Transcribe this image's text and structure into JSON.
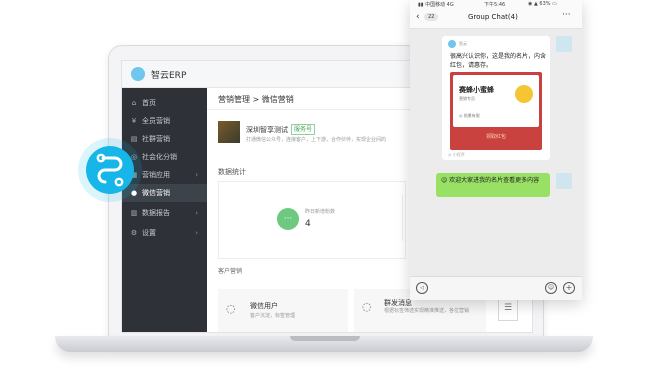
{
  "app": {
    "title": "智云ERP"
  },
  "sidebar": {
    "items": [
      {
        "icon": "home-icon",
        "glyph": "⌂",
        "label": "首页",
        "chevron": false
      },
      {
        "icon": "coins-icon",
        "glyph": "¥",
        "label": "全员营销",
        "chevron": false
      },
      {
        "icon": "chart-icon",
        "glyph": "▤",
        "label": "社群营销",
        "chevron": false
      },
      {
        "icon": "share-icon",
        "glyph": "◎",
        "label": "社会化分销",
        "chevron": false
      },
      {
        "icon": "apps-icon",
        "glyph": "▦",
        "label": "营销应用",
        "chevron": true
      },
      {
        "icon": "wechat-icon",
        "glyph": "●",
        "label": "微信营销",
        "chevron": false,
        "active": true
      },
      {
        "icon": "report-icon",
        "glyph": "▥",
        "label": "数据报告",
        "chevron": true
      },
      {
        "icon": "gear-icon",
        "glyph": "⚙",
        "label": "设置",
        "chevron": true
      }
    ],
    "chevron_glyph": "›"
  },
  "main": {
    "breadcrumb": "营销管理 > 微信营销",
    "profile": {
      "name": "深圳智享测试",
      "badge": "服务号",
      "desc": "打通微信公众号，连接客户，上下游，合作伙伴，实现企业间的"
    },
    "stats": {
      "section_label": "数据统计",
      "caption": "昨日新增粉数",
      "value": "4"
    },
    "marketing": {
      "section_label": "客户营销",
      "users_title": "微信用户",
      "users_sub": "客户沉淀，标签管理",
      "msg_title": "群发消息",
      "msg_sub": "根据标签筛选实现精准推送，各位营销"
    }
  },
  "phone": {
    "status": {
      "carrier": "▮▮ 中国移动 4G",
      "time": "下午5:46",
      "battery": "◉ ▲ 63% ▭"
    },
    "nav": {
      "back": "‹",
      "count": "22",
      "title": "Group Chat(4)",
      "more": "···"
    },
    "card": {
      "from": "智云",
      "text": "很高兴认识你，这是我的名片，内含红包，请惠存。",
      "name": "赛蜂小蜜蜂",
      "role": "营销专员",
      "more": "◎ 前景有限",
      "button": "领取红包",
      "footer": "◎ 小程序"
    },
    "message": "😉 欢迎大家进我的名片查看更多内容",
    "input": {
      "voice": "◁",
      "emoji": "☺",
      "plus": "+"
    }
  }
}
